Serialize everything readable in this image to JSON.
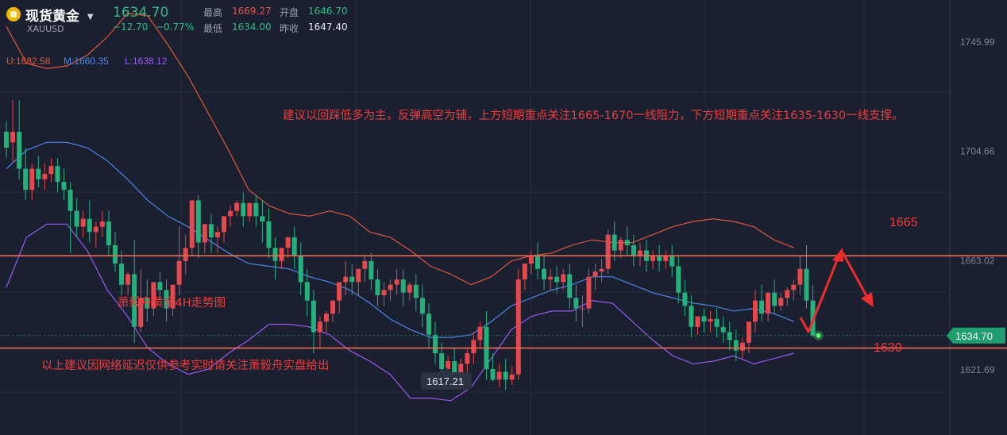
{
  "header": {
    "name": "现货黄金",
    "symbol": "XAUUSD",
    "price": "1634.70",
    "change": "−12.70",
    "change_pct": "−0.77%",
    "high_label": "最高",
    "high": "1669.27",
    "open_label": "开盘",
    "open": "1646.70",
    "low_label": "最低",
    "low": "1634.00",
    "prev_close_label": "昨收",
    "prev_close": "1647.40"
  },
  "indicator": {
    "upper": "U:1682.58",
    "middle": "M:1660.35",
    "lower": "L:1638.12"
  },
  "annotations": {
    "advice": "建议以回踩低多为主，反弹高空为辅，上方短期重点关注1665-1670一线阻力，下方短期重点关注1635-1630一线支撑。",
    "chart_name": "萧毅舟黄金4H走势图",
    "disclaimer": "以上建议因网络延迟仅供参考实时请关注萧毅舟实盘给出",
    "resistance_label": "1665",
    "support_label": "1630",
    "low_marker": "1617.21"
  },
  "colors": {
    "background": "#1b2030",
    "up": "#e5484d",
    "down": "#26b07c",
    "upper_band": "#e0553d",
    "middle_band": "#4a86e8",
    "lower_band": "#9b59f0",
    "level_line": "#ee6a4e",
    "price_tag": "#1f9e6e",
    "annotation": "#ee3b3b"
  },
  "chart_data": {
    "type": "candlestick",
    "y_axis_ticks": [
      "1745.99",
      "1704.66",
      "1663.02",
      "1621.69"
    ],
    "ylim": [
      1597,
      1762
    ],
    "current_price": "1634.70",
    "resistance": 1665,
    "support": 1630,
    "indicator": "Bollinger Bands",
    "candles": [
      [
        1712,
        1716,
        1706,
        1702
      ],
      [
        1708,
        1724,
        1712,
        1700
      ],
      [
        1712,
        1724,
        1698,
        1694
      ],
      [
        1698,
        1706,
        1690,
        1686
      ],
      [
        1690,
        1700,
        1698,
        1686
      ],
      [
        1698,
        1703,
        1694,
        1691
      ],
      [
        1694,
        1700,
        1696,
        1690
      ],
      [
        1696,
        1702,
        1699,
        1693
      ],
      [
        1699,
        1702,
        1693,
        1689
      ],
      [
        1693,
        1698,
        1690,
        1686
      ],
      [
        1690,
        1693,
        1682,
        1666
      ],
      [
        1682,
        1687,
        1676,
        1672
      ],
      [
        1676,
        1682,
        1679,
        1672
      ],
      [
        1679,
        1686,
        1674,
        1670
      ],
      [
        1674,
        1678,
        1676,
        1668
      ],
      [
        1676,
        1682,
        1678,
        1672
      ],
      [
        1678,
        1682,
        1669,
        1665
      ],
      [
        1669,
        1674,
        1662,
        1659
      ],
      [
        1662,
        1667,
        1654,
        1650
      ],
      [
        1654,
        1659,
        1658,
        1650
      ],
      [
        1658,
        1671,
        1638,
        1632
      ],
      [
        1638,
        1660,
        1649,
        1636
      ],
      [
        1649,
        1656,
        1645,
        1640
      ],
      [
        1645,
        1652,
        1655,
        1642
      ],
      [
        1655,
        1659,
        1652,
        1648
      ],
      [
        1652,
        1656,
        1645,
        1640
      ],
      [
        1645,
        1650,
        1654,
        1642
      ],
      [
        1654,
        1676,
        1663,
        1650
      ],
      [
        1663,
        1673,
        1668,
        1658
      ],
      [
        1668,
        1678,
        1686,
        1665
      ],
      [
        1686,
        1688,
        1670,
        1664
      ],
      [
        1670,
        1676,
        1677,
        1666
      ],
      [
        1677,
        1681,
        1672,
        1666
      ],
      [
        1672,
        1676,
        1674,
        1666
      ],
      [
        1674,
        1680,
        1680,
        1670
      ],
      [
        1680,
        1684,
        1682,
        1676
      ],
      [
        1682,
        1686,
        1685,
        1680
      ],
      [
        1685,
        1689,
        1680,
        1676
      ],
      [
        1680,
        1684,
        1685,
        1678
      ],
      [
        1685,
        1688,
        1680,
        1676
      ],
      [
        1680,
        1686,
        1678,
        1670
      ],
      [
        1678,
        1683,
        1668,
        1664
      ],
      [
        1668,
        1672,
        1663,
        1656
      ],
      [
        1663,
        1668,
        1668,
        1660
      ],
      [
        1668,
        1672,
        1672,
        1664
      ],
      [
        1672,
        1676,
        1665,
        1660
      ],
      [
        1665,
        1670,
        1655,
        1650
      ],
      [
        1655,
        1660,
        1648,
        1642
      ],
      [
        1648,
        1652,
        1636,
        1628
      ],
      [
        1636,
        1642,
        1640,
        1630
      ],
      [
        1640,
        1644,
        1643,
        1636
      ],
      [
        1643,
        1647,
        1648,
        1640
      ],
      [
        1648,
        1653,
        1655,
        1643
      ],
      [
        1655,
        1663,
        1657,
        1650
      ],
      [
        1657,
        1662,
        1655,
        1650
      ],
      [
        1655,
        1659,
        1660,
        1650
      ],
      [
        1660,
        1665,
        1663,
        1655
      ],
      [
        1663,
        1666,
        1656,
        1652
      ],
      [
        1656,
        1660,
        1650,
        1646
      ],
      [
        1650,
        1655,
        1652,
        1646
      ],
      [
        1652,
        1656,
        1654,
        1648
      ],
      [
        1654,
        1660,
        1656,
        1650
      ],
      [
        1656,
        1660,
        1651,
        1646
      ],
      [
        1651,
        1655,
        1654,
        1648
      ],
      [
        1654,
        1658,
        1649,
        1644
      ],
      [
        1649,
        1654,
        1643,
        1638
      ],
      [
        1643,
        1647,
        1635,
        1630
      ],
      [
        1635,
        1640,
        1628,
        1624
      ],
      [
        1628,
        1632,
        1622,
        1618
      ],
      [
        1622,
        1627,
        1625,
        1620
      ],
      [
        1625,
        1630,
        1620,
        1616
      ],
      [
        1620,
        1626,
        1624,
        1618
      ],
      [
        1624,
        1630,
        1628,
        1620
      ],
      [
        1628,
        1636,
        1633,
        1624
      ],
      [
        1633,
        1640,
        1638,
        1630
      ],
      [
        1638,
        1644,
        1622,
        1618
      ],
      [
        1622,
        1628,
        1618,
        1617.21
      ],
      [
        1618,
        1624,
        1621,
        1615
      ],
      [
        1621,
        1626,
        1618,
        1614
      ],
      [
        1618,
        1623,
        1620,
        1616
      ],
      [
        1620,
        1660,
        1656,
        1618
      ],
      [
        1656,
        1662,
        1662,
        1652
      ],
      [
        1662,
        1667,
        1665,
        1658
      ],
      [
        1665,
        1670,
        1660,
        1656
      ],
      [
        1660,
        1665,
        1656,
        1652
      ],
      [
        1656,
        1660,
        1657,
        1652
      ],
      [
        1657,
        1661,
        1655,
        1651
      ],
      [
        1655,
        1660,
        1658,
        1652
      ],
      [
        1658,
        1662,
        1649,
        1645
      ],
      [
        1649,
        1654,
        1645,
        1640
      ],
      [
        1645,
        1650,
        1645,
        1638
      ],
      [
        1645,
        1660,
        1657,
        1643
      ],
      [
        1657,
        1662,
        1659,
        1652
      ],
      [
        1659,
        1664,
        1660,
        1655
      ],
      [
        1660,
        1675,
        1673,
        1658
      ],
      [
        1673,
        1678,
        1667,
        1663
      ],
      [
        1667,
        1672,
        1671,
        1664
      ],
      [
        1671,
        1676,
        1669,
        1665
      ],
      [
        1669,
        1673,
        1665,
        1661
      ],
      [
        1665,
        1670,
        1667,
        1661
      ],
      [
        1667,
        1671,
        1663,
        1659
      ],
      [
        1663,
        1667,
        1665,
        1660
      ],
      [
        1665,
        1669,
        1663,
        1659
      ],
      [
        1663,
        1667,
        1665,
        1660
      ],
      [
        1665,
        1669,
        1661,
        1657
      ],
      [
        1661,
        1665,
        1651,
        1647
      ],
      [
        1651,
        1656,
        1646,
        1642
      ],
      [
        1646,
        1650,
        1638,
        1634
      ],
      [
        1638,
        1642,
        1642,
        1635
      ],
      [
        1642,
        1645,
        1640,
        1636
      ],
      [
        1640,
        1644,
        1641,
        1636
      ],
      [
        1641,
        1645,
        1638,
        1634
      ],
      [
        1638,
        1642,
        1636,
        1632
      ],
      [
        1636,
        1640,
        1633,
        1629
      ],
      [
        1633,
        1637,
        1629,
        1625
      ],
      [
        1629,
        1634,
        1632,
        1626
      ],
      [
        1632,
        1636,
        1640,
        1628
      ],
      [
        1640,
        1652,
        1648,
        1636
      ],
      [
        1648,
        1654,
        1643,
        1640
      ],
      [
        1643,
        1648,
        1651,
        1640
      ],
      [
        1651,
        1656,
        1646,
        1643
      ],
      [
        1646,
        1651,
        1649,
        1644
      ],
      [
        1649,
        1653,
        1652,
        1646
      ],
      [
        1652,
        1656,
        1654,
        1648
      ],
      [
        1654,
        1665,
        1660,
        1650
      ],
      [
        1660,
        1669,
        1648,
        1645
      ],
      [
        1648,
        1654,
        1634.7,
        1634
      ]
    ],
    "bollinger": {
      "upper": [
        1752,
        1738,
        1736,
        1737,
        1741,
        1748,
        1757,
        1756,
        1745,
        1733,
        1719,
        1705,
        1690,
        1684,
        1681,
        1680,
        1682,
        1680,
        1674,
        1672,
        1667,
        1661,
        1658,
        1654,
        1657,
        1663,
        1665,
        1666,
        1669,
        1671,
        1670,
        1670,
        1673,
        1676,
        1678,
        1679,
        1678,
        1676,
        1671,
        1668
      ],
      "middle": [
        1698,
        1705,
        1708,
        1708,
        1706,
        1701,
        1694,
        1686,
        1680,
        1676,
        1671,
        1666,
        1662,
        1661,
        1660,
        1657,
        1655,
        1652,
        1647,
        1641,
        1637,
        1634,
        1634,
        1635,
        1640,
        1646,
        1649,
        1652,
        1654,
        1657,
        1657,
        1654,
        1651,
        1649,
        1647,
        1646,
        1644,
        1645,
        1643,
        1640
      ],
      "lower": [
        1653,
        1672,
        1677,
        1677,
        1667,
        1652,
        1642,
        1630,
        1624,
        1620,
        1622,
        1628,
        1633,
        1639,
        1639,
        1638,
        1635,
        1629,
        1625,
        1620,
        1611,
        1611,
        1610,
        1615,
        1626,
        1637,
        1642,
        1644,
        1644,
        1648,
        1647,
        1640,
        1633,
        1627,
        1624,
        1625,
        1627,
        1624,
        1626,
        1628
      ]
    }
  }
}
